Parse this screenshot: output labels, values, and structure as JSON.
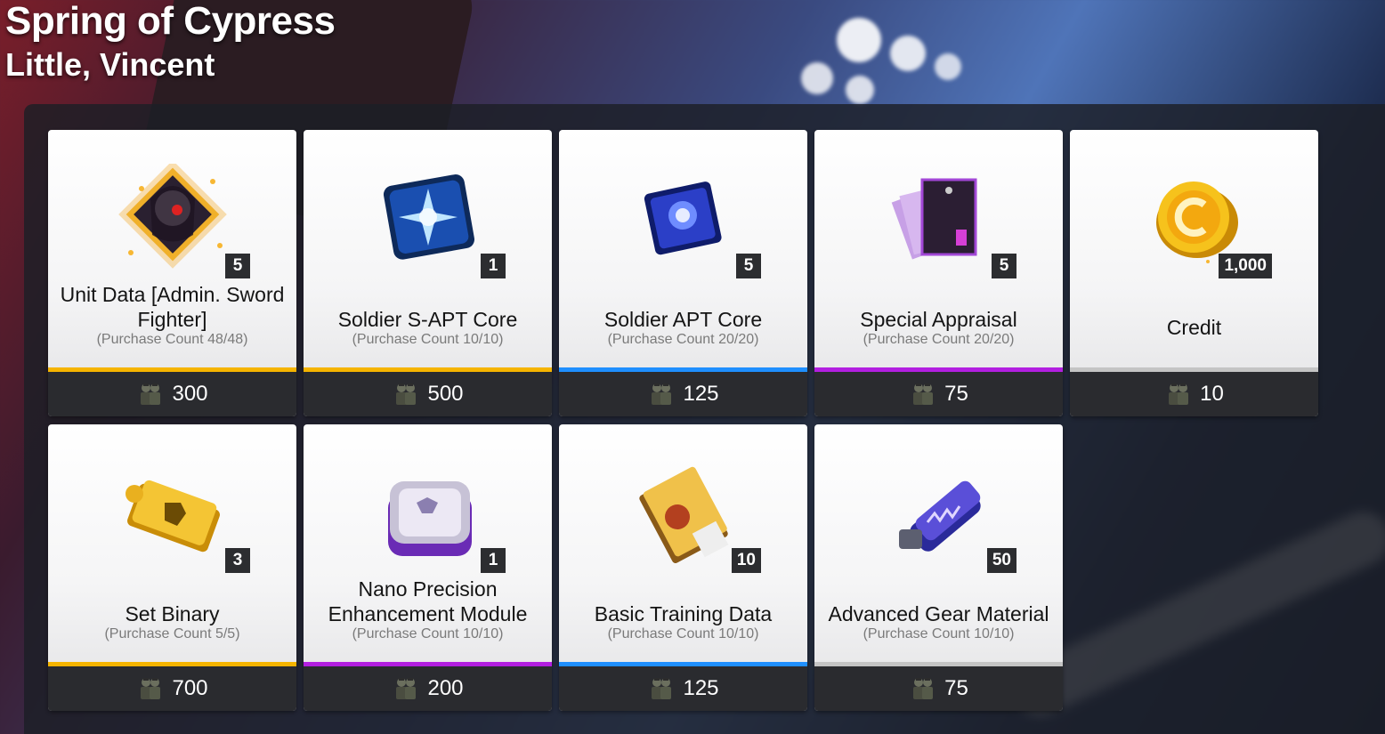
{
  "header": {
    "title": "Spring of Cypress",
    "subtitle": "Little, Vincent"
  },
  "colors": {
    "gold": "#f5b400",
    "blue": "#1f8fff",
    "purple": "#b21fe0",
    "gray": "#c4c4c4"
  },
  "items": [
    {
      "name": "Unit Data [Admin. Sword Fighter]",
      "count": "(Purchase Count 48/48)",
      "qty": "5",
      "price": "300",
      "rarity": "gold",
      "icon": "unit-data-portrait-icon"
    },
    {
      "name": "Soldier S-APT Core",
      "count": "(Purchase Count 10/10)",
      "qty": "1",
      "price": "500",
      "rarity": "gold",
      "icon": "s-apt-core-icon"
    },
    {
      "name": "Soldier APT Core",
      "count": "(Purchase Count 20/20)",
      "qty": "5",
      "price": "125",
      "rarity": "blue",
      "icon": "apt-core-icon"
    },
    {
      "name": "Special Appraisal",
      "count": "(Purchase Count 20/20)",
      "qty": "5",
      "price": "75",
      "rarity": "purple",
      "icon": "special-appraisal-icon"
    },
    {
      "name": "Credit",
      "count": "",
      "qty": "1,000",
      "price": "10",
      "rarity": "gray",
      "icon": "credit-coin-icon"
    },
    {
      "name": "Set Binary",
      "count": "(Purchase Count 5/5)",
      "qty": "3",
      "price": "700",
      "rarity": "gold",
      "icon": "set-binary-icon"
    },
    {
      "name": "Nano Precision Enhancement Module",
      "count": "(Purchase Count 10/10)",
      "qty": "1",
      "price": "200",
      "rarity": "purple",
      "icon": "enhancement-module-icon"
    },
    {
      "name": "Basic Training Data",
      "count": "(Purchase Count 10/10)",
      "qty": "10",
      "price": "125",
      "rarity": "blue",
      "icon": "training-data-icon"
    },
    {
      "name": "Advanced Gear Material",
      "count": "(Purchase Count 10/10)",
      "qty": "50",
      "price": "75",
      "rarity": "gray",
      "icon": "gear-material-icon"
    }
  ],
  "currency_icon": "soldier-token-icon"
}
